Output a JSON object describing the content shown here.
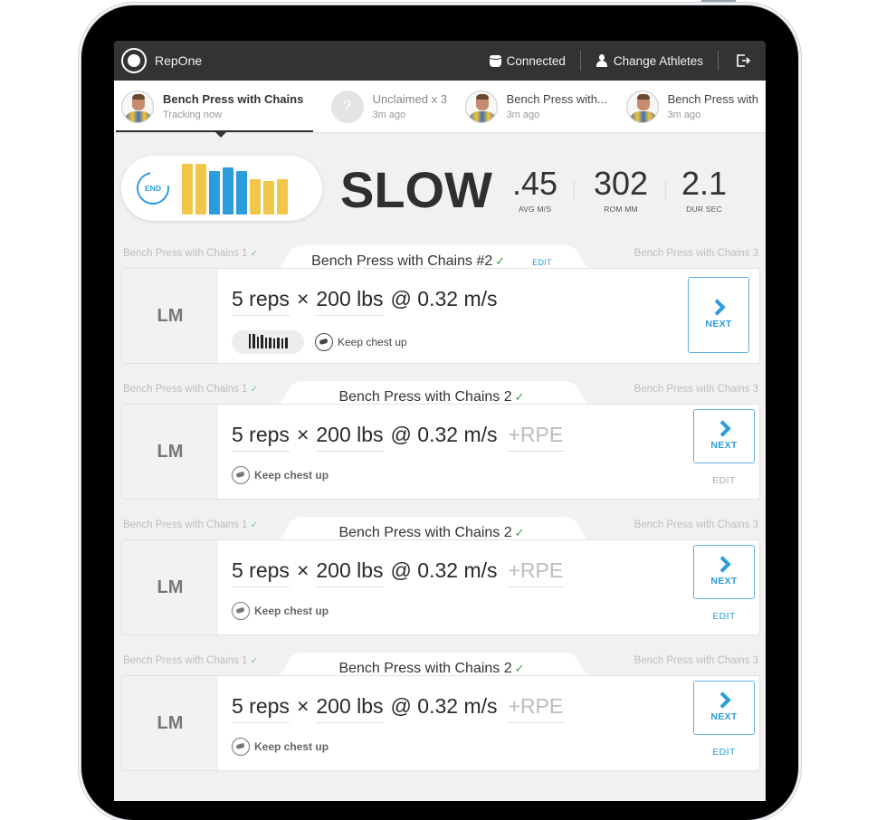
{
  "app": {
    "name": "RepOne",
    "status": "Connected",
    "change_athletes": "Change Athletes"
  },
  "tabs": [
    {
      "title": "Bench Press with Chains",
      "subtitle": "Tracking now",
      "active": true,
      "avatar": "athlete"
    },
    {
      "title": "Unclaimed x 3",
      "subtitle": "3m ago",
      "active": false,
      "avatar": "unknown",
      "avatar_glyph": "?"
    },
    {
      "title": "Bench Press with...",
      "subtitle": "3m ago",
      "active": false,
      "avatar": "athlete"
    },
    {
      "title": "Bench Press with",
      "subtitle": "3m ago",
      "active": false,
      "avatar": "athlete"
    }
  ],
  "summary": {
    "end_label": "END",
    "verdict": "SLOW",
    "rep_bars": [
      {
        "height": 1.0,
        "color": "#f2c648"
      },
      {
        "height": 1.0,
        "color": "#f2c648"
      },
      {
        "height": 0.85,
        "color": "#2b9cdc"
      },
      {
        "height": 0.92,
        "color": "#2b9cdc"
      },
      {
        "height": 0.85,
        "color": "#2b9cdc"
      },
      {
        "height": 0.7,
        "color": "#f2c648"
      },
      {
        "height": 0.66,
        "color": "#f2c648"
      },
      {
        "height": 0.7,
        "color": "#f2c648"
      }
    ],
    "stats": [
      {
        "value": ".45",
        "label": "AVG M/S"
      },
      {
        "value": "302",
        "label": "ROM MM"
      },
      {
        "value": "2.1",
        "label": "DUR SEC"
      }
    ]
  },
  "sets": [
    {
      "prev": "Bench Press with Chains 1",
      "title": "Bench Press with Chains #2",
      "title_edit": "EDIT",
      "next_set": "Bench Press with Chains 3",
      "athlete_initials": "LM",
      "reps": "5 reps",
      "times": "×",
      "weight": "200 lbs",
      "velocity": "@ 0.32 m/s",
      "rpe": "",
      "cue": "Keep chest up",
      "next_label": "NEXT",
      "edit_label": "",
      "mini_bars": [
        1.0,
        1.0,
        0.8,
        0.95,
        0.75,
        0.75,
        0.7,
        0.75,
        0.7,
        0.75
      ]
    },
    {
      "prev": "Bench Press with Chains 1",
      "title": "Bench Press with Chains 2",
      "title_edit": "",
      "next_set": "Bench Press with Chains 3",
      "athlete_initials": "LM",
      "reps": "5 reps",
      "times": "×",
      "weight": "200 lbs",
      "velocity": "@ 0.32 m/s",
      "rpe": "+RPE",
      "cue": "Keep chest up",
      "next_label": "NEXT",
      "edit_label": "EDIT",
      "edit_color": "#aaaaaa"
    },
    {
      "prev": "Bench Press with Chains 1",
      "title": "Bench Press with Chains 2",
      "title_edit": "",
      "next_set": "Bench Press with Chains 3",
      "athlete_initials": "LM",
      "reps": "5 reps",
      "times": "×",
      "weight": "200 lbs",
      "velocity": "@ 0.32 m/s",
      "rpe": "+RPE",
      "cue": "Keep chest up",
      "next_label": "NEXT",
      "edit_label": "EDIT",
      "edit_color": "#2b9cdc"
    },
    {
      "prev": "Bench Press with Chains 1",
      "title": "Bench Press with Chains 2",
      "title_edit": "",
      "next_set": "Bench Press with Chains 3",
      "athlete_initials": "LM",
      "reps": "5 reps",
      "times": "×",
      "weight": "200 lbs",
      "velocity": "@ 0.32 m/s",
      "rpe": "+RPE",
      "cue": "Keep chest up",
      "next_label": "NEXT",
      "edit_label": "EDIT",
      "edit_color": "#2b9cdc"
    }
  ],
  "colors": {
    "accent": "#2b9cdc",
    "topbar": "#333333",
    "yellow": "#f2c648",
    "check_green": "#2ea44f"
  }
}
